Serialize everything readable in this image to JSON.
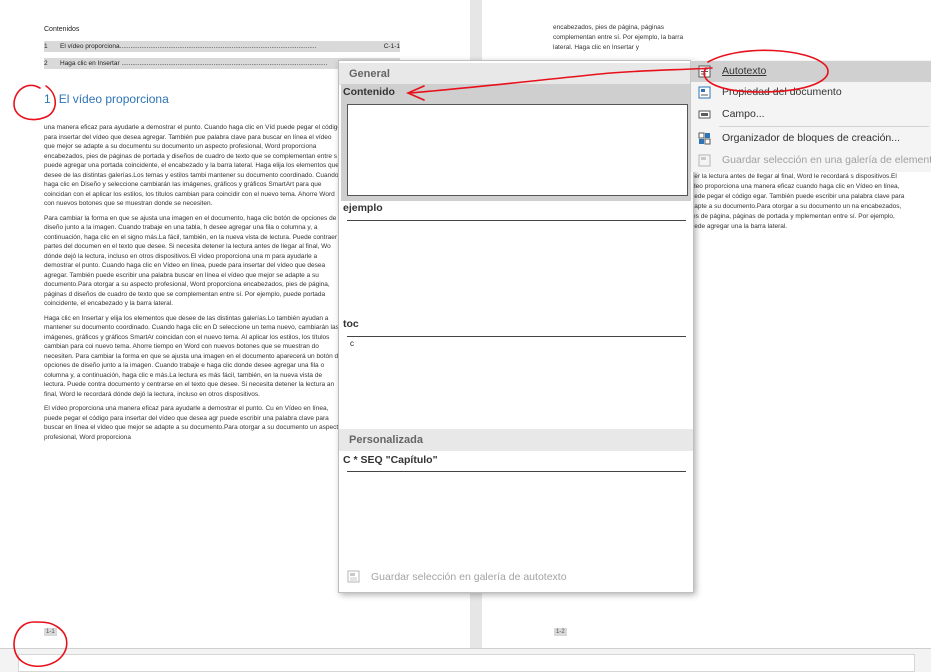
{
  "document": {
    "toc_title": "Contenidos",
    "toc_rows": [
      {
        "num": "1",
        "text": "El vídeo proporciona.............................................................................................................",
        "page": "C-1-1"
      },
      {
        "num": "2",
        "text": "Haga clic en Insertar ..................................................................................................................",
        "page": ""
      }
    ],
    "heading_number": "1",
    "heading_text": "El vídeo proporciona",
    "paragraphs_left": [
      "una manera eficaz para ayudarle a demostrar el punto. Cuando haga clic en Víd puede pegar el código para insertar del vídeo que desea agregar. También pue palabra clave para buscar en línea el vídeo que mejor se adapte a su documentu su documento un aspecto profesional, Word proporciona encabezados, pies de páginas de portada y diseños de cuadro de texto que se complementan entre s puede agregar una portada coincidente, el encabezado y la barra lateral. Haga elija los elementos que desee de las distintas galerías.Los temas y estilos tambi mantener su documento coordinado. Cuando haga clic en Diseño y seleccione cambiarán las imágenes, gráficos y gráficos SmartArt para que coincidan con el aplicar los estilos, los títulos cambian para coincidir con el nuevo tema. Ahorre Word con nuevos botones que se muestran donde se necesiten.",
      "Para cambiar la forma en que se ajusta una imagen en el documento, haga clic botón de opciones de diseño junto a la imagen. Cuando trabaje en una tabla, h desee agregar una fila o columna y, a continuación, haga clic en el signo más.La fácil, también, en la nueva vista de lectura. Puede contraer partes del documen en el texto que desee. Si necesita detener la lectura antes de llegar al final, Wo dónde dejó la lectura, incluso en otros dispositivos.El vídeo proporciona una m para ayudarle a demostrar el punto. Cuando haga clic en Vídeo en línea, puede para insertar del vídeo que desea agregar. También puede escribir una palabra buscar en línea el vídeo que mejor se adapte a su documento.Para otorgar a su aspecto profesional, Word proporciona encabezados, pies de página, páginas d diseños de cuadro de texto que se complementan entre sí. Por ejemplo, puede portada coincidente, el encabezado y la barra lateral.",
      "Haga clic en Insertar y elija los elementos que desee de las distintas galerías.Lo también ayudan a mantener su documento coordinado. Cuando haga clic en D seleccione un tema nuevo, cambiarán las imágenes, gráficos y gráficos SmartAr coincidan con el nuevo tema. Al aplicar los estilos, los títulos cambian para coi nuevo tema. Ahorre tiempo en Word con nuevos botones que se muestran do necesiten. Para cambiar la forma en que se ajusta una imagen en el documento aparecerá un botón de opciones de diseño junto a la imagen. Cuando trabaje e haga clic donde desee agregar una fila o columna y, a continuación, haga clic e más.La lectura es más fácil, también, en la nueva vista de lectura. Puede contra documento y centrarse en el texto que desee. Si necesita detener la lectura an final, Word le recordará dónde dejó la lectura, incluso en otros dispositivos.",
      "El vídeo proporciona una manera eficaz para ayudarle a demostrar el punto. Cu en Vídeo en línea, puede pegar el código para insertar del vídeo que desea agr puede escribir una palabra clave para buscar en línea el vídeo que mejor se adapte a su documento.Para otorgar a su documento un aspecto profesional, Word proporciona"
    ],
    "page_number_left": "1-1",
    "page_number_right": "1-2",
    "right_top_text": "encabezados, pies de página, páginas complementan entre sí. Por ejemplo, la barra lateral. Haga clic en Insertar y",
    "right_low_text": "ener la lectura antes de llegar al final, Word le recordará s dispositivos.El vídeo proporciona una manera eficaz cuando haga clic en Vídeo en línea, puede pegar el código egar. También puede escribir una palabra clave para adapte a su documento.Para otorgar a su documento un na encabezados, pies de página, páginas de portada y mplementan entre sí. Por ejemplo, puede agregar una la barra lateral."
  },
  "gallery": {
    "section_general": "General",
    "items": [
      {
        "label": "Contenido",
        "preview": ""
      },
      {
        "label": "ejemplo",
        "preview": ""
      },
      {
        "label": "toc",
        "preview": "c"
      }
    ],
    "section_custom": "Personalizada",
    "custom_item": {
      "label": "C * SEQ \"Capítulo\"",
      "preview": ""
    },
    "save_label": "Guardar selección en galería de autotexto"
  },
  "quick_parts_menu": {
    "items": [
      {
        "label": "Autotexto",
        "highlighted": true,
        "disabled": false
      },
      {
        "label": "Propiedad del documento",
        "highlighted": false,
        "disabled": false
      },
      {
        "label": "Campo...",
        "highlighted": false,
        "disabled": false
      },
      {
        "label": "Organizador de bloques de creación...",
        "highlighted": false,
        "disabled": false
      },
      {
        "label": "Guardar selección en una galería de elementos",
        "highlighted": false,
        "disabled": true
      }
    ]
  },
  "colors": {
    "heading": "#2e74b5",
    "annotation": "#e8101a",
    "selection": "#cfcfcf"
  }
}
